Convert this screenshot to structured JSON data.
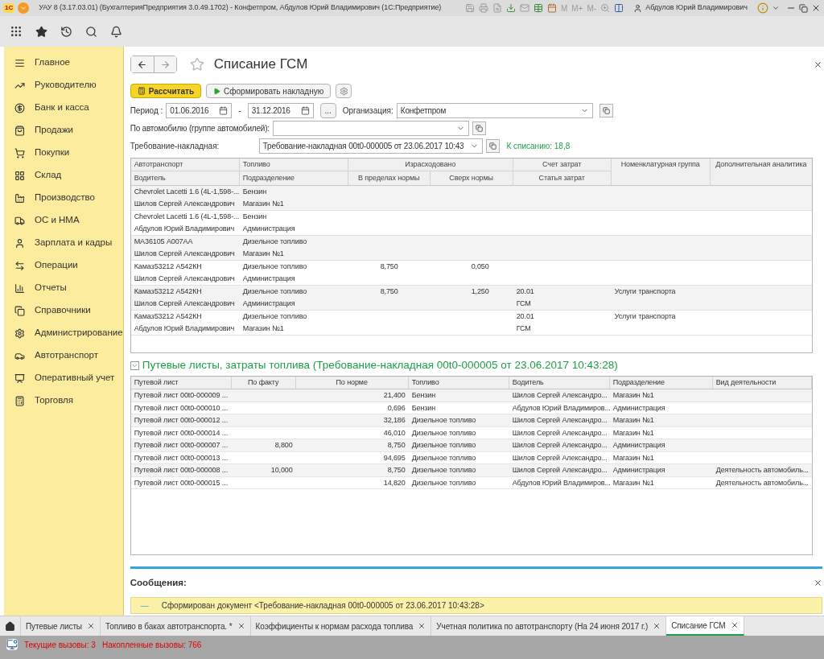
{
  "window": {
    "title": "УАУ 8 (3.17.03.01) (БухгалтерияПредприятия 3.0.49.1702) - Конфетпром, Абдулов Юрий Владимирович  (1С:Предприятие)",
    "logo": "1С",
    "memory_buttons": [
      "M",
      "M+",
      "M-"
    ],
    "user": "Абдулов Юрий Владимирович"
  },
  "sidebar": {
    "items": [
      {
        "label": "Главное"
      },
      {
        "label": "Руководителю"
      },
      {
        "label": "Банк и касса"
      },
      {
        "label": "Продажи"
      },
      {
        "label": "Покупки"
      },
      {
        "label": "Склад"
      },
      {
        "label": "Производство"
      },
      {
        "label": "ОС и НМА"
      },
      {
        "label": "Зарплата и кадры"
      },
      {
        "label": "Операции"
      },
      {
        "label": "Отчеты"
      },
      {
        "label": "Справочники"
      },
      {
        "label": "Администрирование"
      },
      {
        "label": "Автотранспорт"
      },
      {
        "label": "Оперативный учет"
      },
      {
        "label": "Торговля"
      }
    ]
  },
  "form": {
    "title": "Списание ГСМ",
    "buttons": [
      {
        "label": "Рассчитать",
        "kind": "primary"
      },
      {
        "label": "Сформировать накладную",
        "kind": "run"
      }
    ],
    "period_label": "Период :",
    "period_from": "01.06.2016",
    "period_sep": "-",
    "period_to": "31.12.2016",
    "ellipsis": "...",
    "org_label": "Организация:",
    "org_value": "Конфетпром",
    "car_label": "По автомобилю (группе автомобилей):",
    "invoice_label": "Требование-накладная:",
    "invoice_value": "Требование-накладная 00t0-000005 от 23.06.2017 10:43",
    "writeoff": "К списанию: 18,8"
  },
  "upper_table": {
    "headers": {
      "vehicle": "Автотранспорт",
      "fuel": "Топливо",
      "consumed": "Израсходовано",
      "account": "Счет затрат",
      "group": "Номенклатурная группа",
      "analytics": "Дополнительная аналитика",
      "driver": "Водитель",
      "department": "Подразделение",
      "within": "В пределах нормы",
      "over": "Сверх нормы",
      "cost_item": "Статья затрат"
    },
    "rows": [
      {
        "vehicle": "Chevrolet Lacetti 1.6 (4L-1,598-...",
        "fuel": "Бензин",
        "driver": "Шилов Сергей Александрович",
        "department": "Магазин №1"
      },
      {
        "vehicle": "Chevrolet Lacetti 1.6 (4L-1,598-...",
        "fuel": "Бензин",
        "driver": "Абдулов Юрий Владимирович",
        "department": "Администрация"
      },
      {
        "vehicle": "МА36105 А007АА",
        "fuel": "Дизельное топливо",
        "driver": "Шилов Сергей Александрович",
        "department": "Магазин №1"
      },
      {
        "vehicle": "Камаз53212 А542КН",
        "fuel": "Дизельное топливо",
        "within": "8,750",
        "over": "0,050",
        "driver": "Шилов Сергей Александрович",
        "department": "Администрация"
      },
      {
        "vehicle": "Камаз53212 А542КН",
        "fuel": "Дизельное топливо",
        "within": "8,750",
        "over": "1,250",
        "account": "20.01",
        "group": "Услуги транспорта",
        "driver": "Шилов Сергей Александрович",
        "department": "Администрация",
        "cost_item": "ГСМ"
      },
      {
        "vehicle": "Камаз53212 А542КН",
        "fuel": "Дизельное топливо",
        "account": "20.01",
        "group": "Услуги транспорта",
        "driver": "Абдулов Юрий Владимирович",
        "department": "Магазин №1",
        "cost_item": "ГСМ"
      }
    ]
  },
  "waybills": {
    "title": "Путевые листы, затраты топлива (Требование-накладная 00t0-000005 от 23.06.2017 10:43:28)",
    "expanded": true,
    "columns": [
      "Путевой лист",
      "По факту",
      "По норме",
      "Топливо",
      "Водитель",
      "Подразделение",
      "Вид деятельности"
    ],
    "rows": [
      [
        "Путевой лист 00t0-000009 ...",
        "",
        "21,400",
        "Бензин",
        "Шилов Сергей Александро...",
        "Магазин №1",
        ""
      ],
      [
        "Путевой лист 00t0-000010 ...",
        "",
        "0,696",
        "Бензин",
        "Абдулов Юрий Владимиров...",
        "Администрация",
        ""
      ],
      [
        "Путевой лист 00t0-000012 ...",
        "",
        "32,186",
        "Дизельное топливо",
        "Шилов Сергей Александро...",
        "Магазин №1",
        ""
      ],
      [
        "Путевой лист 00t0-000014 ...",
        "",
        "46,010",
        "Дизельное топливо",
        "Шилов Сергей Александро...",
        "Магазин №1",
        ""
      ],
      [
        "Путевой лист 00t0-000007 ...",
        "8,800",
        "8,750",
        "Дизельное топливо",
        "Шилов Сергей Александро...",
        "Администрация",
        ""
      ],
      [
        "Путевой лист 00t0-000013 ...",
        "",
        "94,695",
        "Дизельное топливо",
        "Шилов Сергей Александро...",
        "Магазин №1",
        ""
      ],
      [
        "Путевой лист 00t0-000008 ...",
        "10,000",
        "8,750",
        "Дизельное топливо",
        "Шилов Сергей Александро...",
        "Администрация",
        "Деятельность автомобиль..."
      ],
      [
        "Путевой лист 00t0-000015 ...",
        "",
        "14,820",
        "Дизельное топливо",
        "Абдулов Юрий Владимиров...",
        "Магазин №1",
        "Деятельность автомобиль..."
      ]
    ]
  },
  "messages": {
    "title": "Сообщения:",
    "items": [
      {
        "bullet": "—",
        "text": "Сформирован  документ <Требование-накладная 00t0-000005 от 23.06.2017 10:43:28>"
      }
    ]
  },
  "open_tabs": [
    {
      "label": "Путевые листы",
      "selected": false
    },
    {
      "label": "Топливо в баках автотранспорта. *",
      "selected": false
    },
    {
      "label": "Коэффициенты к нормам расхода топлива",
      "selected": false
    },
    {
      "label": "Учетная политика по автотранспорту (На 24 июня 2017 г.)",
      "selected": false
    },
    {
      "label": "Списание ГСМ",
      "selected": true
    }
  ],
  "status_bar": {
    "current_calls": "Текущие вызовы: 3",
    "accumulated_calls": "Накопленные вызовы: 766"
  }
}
